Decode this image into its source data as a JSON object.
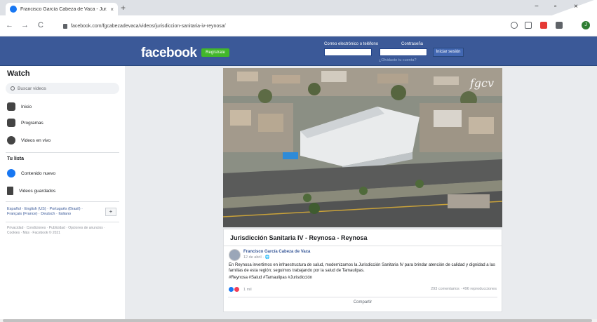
{
  "browser": {
    "tab_title": "Francisco García Cabeza de Vaca - Jur...",
    "tab_close": "×",
    "new_tab": "+",
    "url": "facebook.com/fgcabezadevaca/videos/jurisdiccion-sanitaria-iv-reynosa/",
    "nav_back": "←",
    "nav_forward": "→",
    "nav_reload": "C",
    "avatar_letter": "J",
    "win_min": "−",
    "win_max": "▫",
    "win_close": "×"
  },
  "header": {
    "logo": "facebook",
    "register": "Regístrate",
    "email_label": "Correo electrónico o teléfono",
    "password_label": "Contraseña",
    "login_button": "Iniciar sesión",
    "forgot": "¿Olvidaste tu cuenta?"
  },
  "sidebar": {
    "title": "Watch",
    "search_placeholder": "Buscar videos",
    "items": [
      {
        "label": "Inicio",
        "icon": "home-icon"
      },
      {
        "label": "Programas",
        "icon": "shows-icon"
      },
      {
        "label": "Videos en vivo",
        "icon": "live-icon"
      }
    ],
    "section_title": "Tu lista",
    "list_items": [
      {
        "label": "Contenido nuevo",
        "icon": "play-icon"
      },
      {
        "label": "Videos guardados",
        "icon": "bookmark-icon"
      }
    ],
    "languages": "Español · English (US) · Português (Brasil) · Français (France) · Deutsch · Italiano",
    "lang_more": "+",
    "footer": "Privacidad · Condiciones · Publicidad · Opciones de anuncios · Cookies · Más · Facebook © 2021"
  },
  "post": {
    "watermark": "fgcv",
    "title": "Jurisdicción Sanitaria IV - Reynosa - Reynosa",
    "author": "Francisco García Cabeza de Vaca",
    "time": "12 de abril · 🌐",
    "text": "En Reynosa invertimos en infraestructura de salud, modernizamos la Jurisdicción Sanitaria IV para brindar atención de calidad y dignidad a las familias de esta región; seguimos trabajando por la salud de Tamaulipas.",
    "tags": "#Reynosa #Salud #Tamaulipas #Jurisdicción",
    "reaction_count": "1 mil",
    "stats": "293 comentarios · 496 reproducciones",
    "share": "Compartir"
  },
  "colors": {
    "fb_blue": "#3b5998",
    "register_green": "#42b72a",
    "link_blue": "#385898"
  }
}
